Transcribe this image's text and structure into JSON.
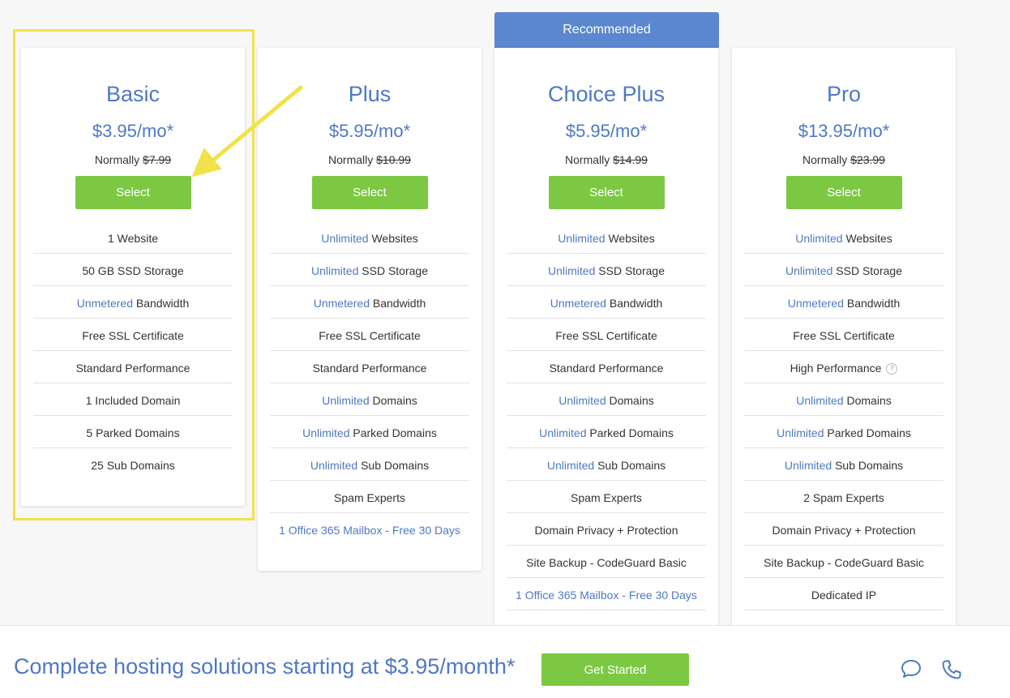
{
  "recommended_label": "Recommended",
  "plans": [
    {
      "name": "Basic",
      "price": "$3.95/mo*",
      "normally_label": "Normally",
      "normally_price": "$7.99",
      "select_label": "Select",
      "features": [
        {
          "highlight": "",
          "text": "1 Website"
        },
        {
          "highlight": "",
          "text": "50 GB SSD Storage"
        },
        {
          "highlight": "Unmetered",
          "text": " Bandwidth"
        },
        {
          "highlight": "",
          "text": "Free SSL Certificate"
        },
        {
          "highlight": "",
          "text": "Standard Performance"
        },
        {
          "highlight": "",
          "text": "1 Included Domain"
        },
        {
          "highlight": "",
          "text": "5 Parked Domains"
        },
        {
          "highlight": "",
          "text": "25 Sub Domains"
        }
      ]
    },
    {
      "name": "Plus",
      "price": "$5.95/mo*",
      "normally_label": "Normally",
      "normally_price": "$10.99",
      "select_label": "Select",
      "features": [
        {
          "highlight": "Unlimited",
          "text": " Websites"
        },
        {
          "highlight": "Unlimited",
          "text": " SSD Storage"
        },
        {
          "highlight": "Unmetered",
          "text": " Bandwidth"
        },
        {
          "highlight": "",
          "text": "Free SSL Certificate"
        },
        {
          "highlight": "",
          "text": "Standard Performance"
        },
        {
          "highlight": "Unlimited",
          "text": " Domains"
        },
        {
          "highlight": "Unlimited",
          "text": " Parked Domains"
        },
        {
          "highlight": "Unlimited",
          "text": " Sub Domains"
        },
        {
          "highlight": "",
          "text": "Spam Experts"
        },
        {
          "highlight": "1 Office 365 Mailbox - Free 30 Days",
          "text": ""
        }
      ]
    },
    {
      "name": "Choice Plus",
      "price": "$5.95/mo*",
      "normally_label": "Normally",
      "normally_price": "$14.99",
      "select_label": "Select",
      "features": [
        {
          "highlight": "Unlimited",
          "text": " Websites"
        },
        {
          "highlight": "Unlimited",
          "text": " SSD Storage"
        },
        {
          "highlight": "Unmetered",
          "text": " Bandwidth"
        },
        {
          "highlight": "",
          "text": "Free SSL Certificate"
        },
        {
          "highlight": "",
          "text": "Standard Performance"
        },
        {
          "highlight": "Unlimited",
          "text": " Domains"
        },
        {
          "highlight": "Unlimited",
          "text": " Parked Domains"
        },
        {
          "highlight": "Unlimited",
          "text": " Sub Domains"
        },
        {
          "highlight": "",
          "text": "Spam Experts"
        },
        {
          "highlight": "",
          "text": "Domain Privacy + Protection"
        },
        {
          "highlight": "",
          "text": "Site Backup - CodeGuard Basic"
        },
        {
          "highlight": "1 Office 365 Mailbox - Free 30 Days",
          "text": ""
        }
      ]
    },
    {
      "name": "Pro",
      "price": "$13.95/mo*",
      "normally_label": "Normally",
      "normally_price": "$23.99",
      "select_label": "Select",
      "features": [
        {
          "highlight": "Unlimited",
          "text": " Websites"
        },
        {
          "highlight": "Unlimited",
          "text": " SSD Storage"
        },
        {
          "highlight": "Unmetered",
          "text": " Bandwidth"
        },
        {
          "highlight": "",
          "text": "Free SSL Certificate"
        },
        {
          "highlight": "",
          "text": "High Performance",
          "info": "?"
        },
        {
          "highlight": "Unlimited",
          "text": " Domains"
        },
        {
          "highlight": "Unlimited",
          "text": " Parked Domains"
        },
        {
          "highlight": "Unlimited",
          "text": " Sub Domains"
        },
        {
          "highlight": "",
          "text": "2 Spam Experts"
        },
        {
          "highlight": "",
          "text": "Domain Privacy + Protection"
        },
        {
          "highlight": "",
          "text": "Site Backup - CodeGuard Basic"
        },
        {
          "highlight": "",
          "text": "Dedicated IP"
        }
      ]
    }
  ],
  "bottom_bar": {
    "text": "Complete hosting solutions starting at $3.95/month*",
    "button_label": "Get Started"
  },
  "icons": {
    "chat": "chat-bubble-icon",
    "phone": "phone-icon",
    "arrow": "annotation-arrow-icon"
  },
  "colors": {
    "accent_blue": "#4f78c4",
    "recommended_bg": "#5b87cf",
    "button_green": "#7dc843",
    "highlight_yellow": "#f0e24b"
  }
}
